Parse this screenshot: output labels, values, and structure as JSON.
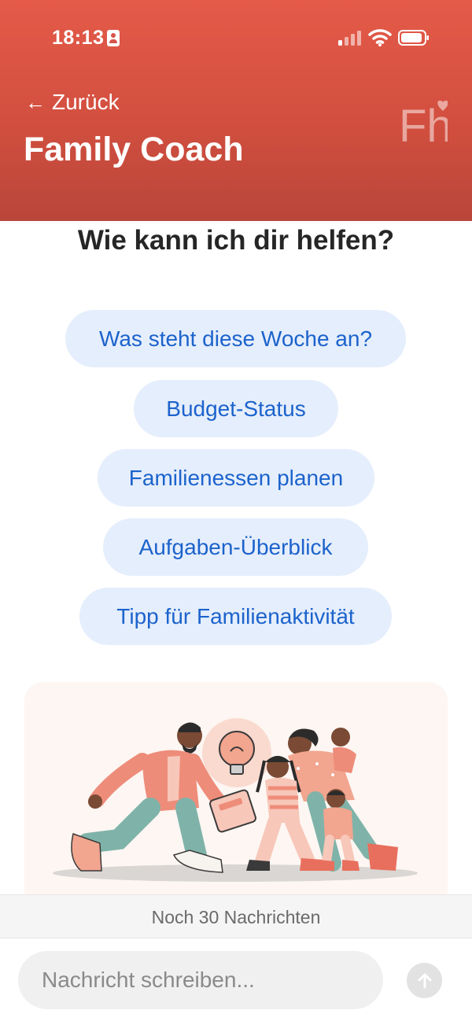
{
  "status_bar": {
    "time": "18:13",
    "icons": [
      "sim-card-icon",
      "cellular-signal-icon",
      "wifi-icon",
      "battery-icon"
    ],
    "signal_bars_active": 1,
    "signal_bars_total": 4
  },
  "header": {
    "back_label": "Zurück",
    "back_icon": "arrow-left-icon",
    "title": "Family Coach",
    "logo_text": "Fh",
    "logo_icon": "heart-icon",
    "gradient_colors": [
      "#e55a49",
      "#b9463a"
    ]
  },
  "main": {
    "heading": "Wie kann ich dir helfen?",
    "suggestions": [
      {
        "label": "Was steht diese Woche an?"
      },
      {
        "label": "Budget-Status"
      },
      {
        "label": "Familienessen planen"
      },
      {
        "label": "Aufgaben-Überblick"
      },
      {
        "label": "Tipp für Familienaktivität"
      }
    ],
    "chip_colors": {
      "background": "#e5eefc",
      "text": "#1c63cc"
    }
  },
  "illustration": {
    "subject": "family-walking-with-phone-and-lightbulb",
    "icons": [
      "lightbulb-icon",
      "phone-icon"
    ]
  },
  "footer": {
    "remaining_messages": "Noch 30 Nachrichten",
    "input_placeholder": "Nachricht schreiben...",
    "send_icon": "arrow-up-icon"
  }
}
